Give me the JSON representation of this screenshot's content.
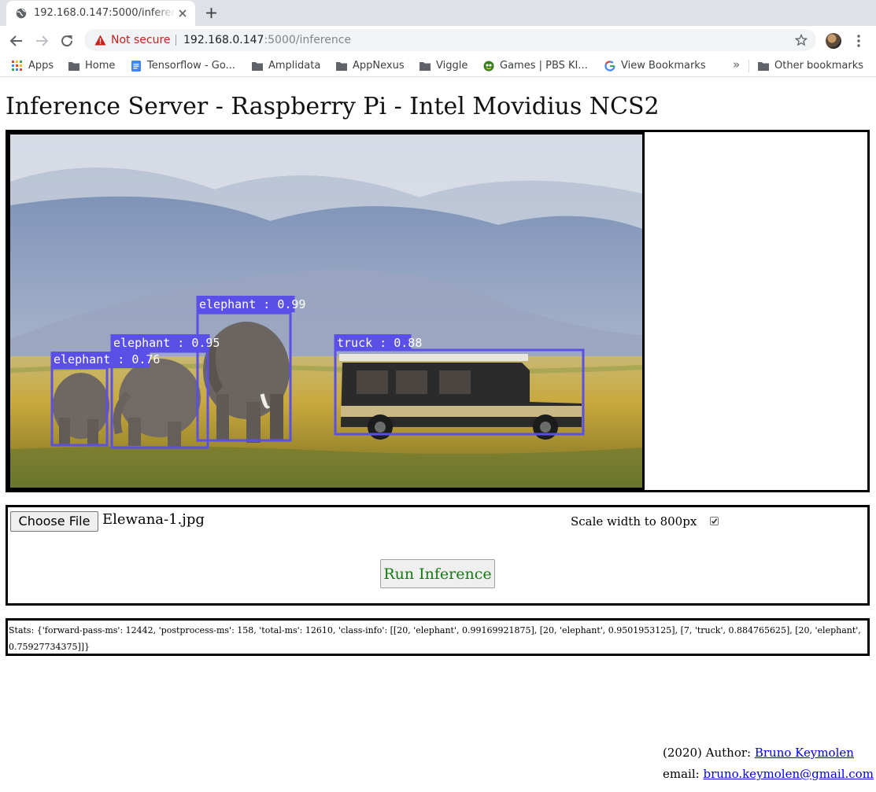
{
  "browser": {
    "tab_title": "192.168.0.147:5000/inference",
    "security_label": "Not secure",
    "url_host": "192.168.0.147",
    "url_path": ":5000/inference",
    "bookmarks": [
      {
        "label": "Apps",
        "icon": "apps-grid-icon"
      },
      {
        "label": "Home",
        "icon": "folder-icon"
      },
      {
        "label": "Tensorflow - Go...",
        "icon": "docs-icon"
      },
      {
        "label": "Amplidata",
        "icon": "folder-icon"
      },
      {
        "label": "AppNexus",
        "icon": "folder-icon"
      },
      {
        "label": "Viggle",
        "icon": "folder-icon"
      },
      {
        "label": "Games | PBS KI...",
        "icon": "pbs-kids-icon"
      },
      {
        "label": "View Bookmarks",
        "icon": "google-icon"
      }
    ],
    "bookmarks_more": "»",
    "other_bookmarks": "Other bookmarks"
  },
  "page": {
    "heading": "Inference Server - Raspberry Pi - Intel Movidius NCS2",
    "detections": [
      {
        "label": "elephant : 0.99"
      },
      {
        "label": "elephant : 0.95"
      },
      {
        "label": "elephant : 0.76"
      },
      {
        "label": "truck : 0.88"
      }
    ],
    "box_color": "#5a4fe6",
    "choose_file_label": "Choose File",
    "file_name": "Elewana-1.jpg",
    "scale_label": "Scale width to 800px",
    "scale_checked": true,
    "run_label": "Run Inference",
    "run_color": "#137a13",
    "stats": "Stats: {'forward-pass-ms': 12442, 'postprocess-ms': 158, 'total-ms': 12610, 'class-info': [[20, 'elephant', 0.99169921875], [20, 'elephant', 0.9501953125], [7, 'truck', 0.884765625], [20, 'elephant', 0.75927734375]]}",
    "footer_author_prefix": "(2020) Author: ",
    "footer_author_name": "Bruno Keymolen",
    "footer_email_prefix": "email: ",
    "footer_email": "bruno.keymolen@gmail.com"
  }
}
